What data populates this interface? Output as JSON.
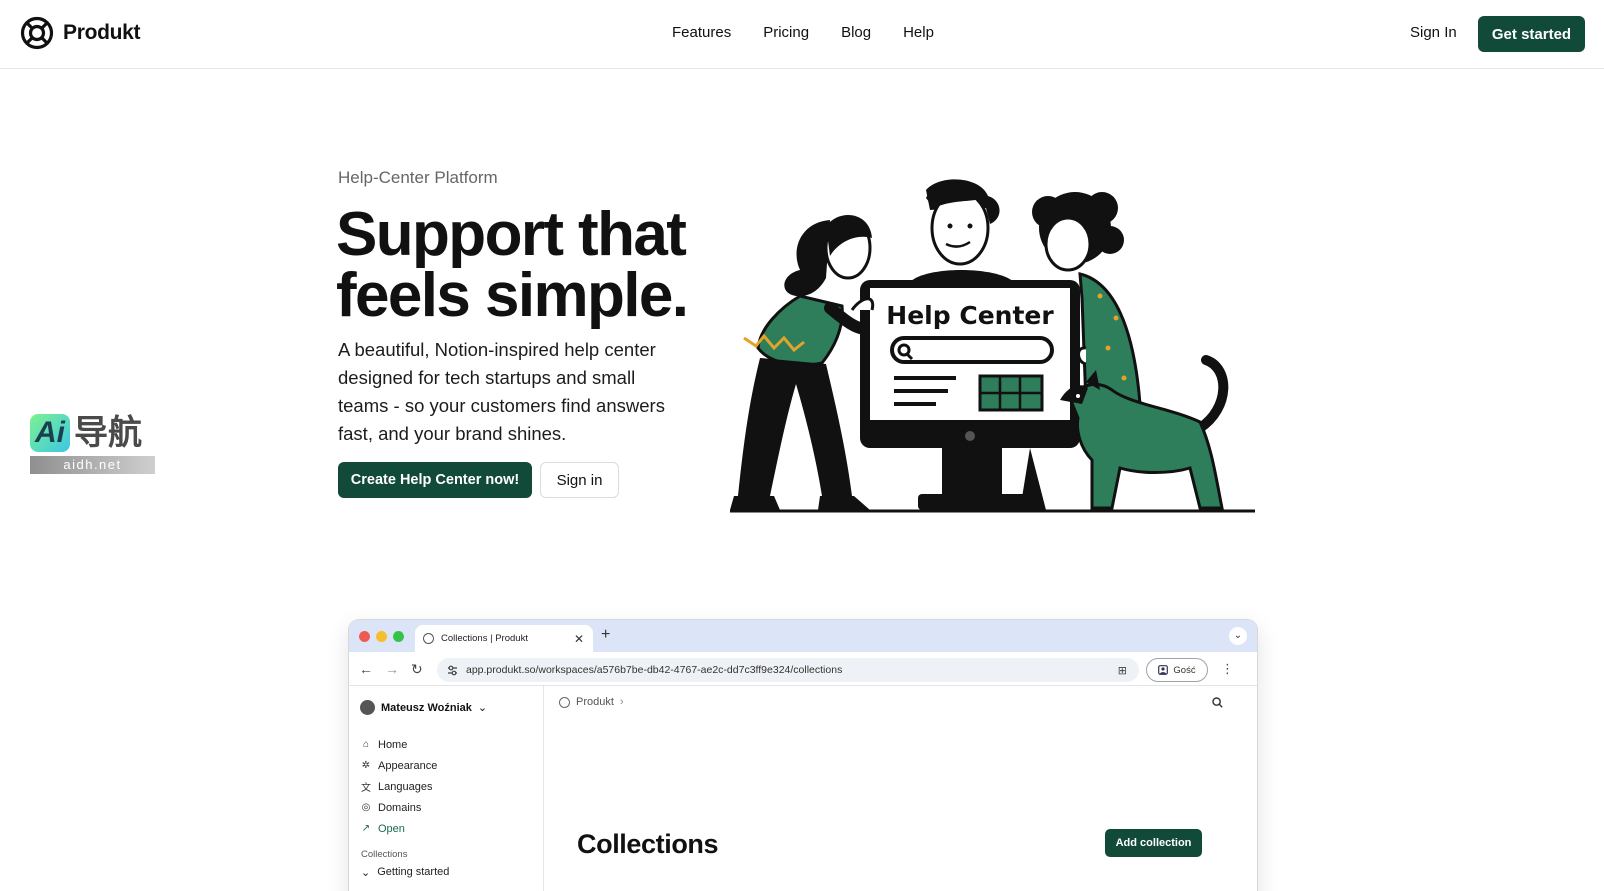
{
  "brand": {
    "name": "Produkt"
  },
  "nav": {
    "links": [
      "Features",
      "Pricing",
      "Blog",
      "Help"
    ],
    "sign_in": "Sign In",
    "get_started": "Get started"
  },
  "hero": {
    "eyebrow": "Help-Center Platform",
    "title_line1": "Support that",
    "title_line2": "feels simple.",
    "description": "A beautiful, Notion-inspired help center designed for tech startups and small teams - so your customers find answers fast, and your brand shines.",
    "cta_primary": "Create Help Center now!",
    "cta_secondary": "Sign in"
  },
  "illustration": {
    "screen_title": "Help Center"
  },
  "watermark": {
    "badge": "Ai",
    "text": "导航",
    "url": "aidh.net"
  },
  "browser": {
    "tab_title": "Collections | Produkt",
    "url": "app.produkt.so/workspaces/a576b7be-db42-4767-ae2c-dd7c3ff9e324/collections",
    "guest_label": "Gość",
    "app": {
      "user_name": "Mateusz Woźniak",
      "menu": [
        {
          "label": "Home",
          "icon": "home-icon"
        },
        {
          "label": "Appearance",
          "icon": "sparkle-icon"
        },
        {
          "label": "Languages",
          "icon": "translate-icon"
        },
        {
          "label": "Domains",
          "icon": "globe-icon"
        },
        {
          "label": "Open",
          "icon": "external-arrow-icon"
        }
      ],
      "collections_label": "Collections",
      "collection_item": "Getting started",
      "breadcrumb": "Produkt",
      "page_title": "Collections",
      "add_collection": "Add collection"
    }
  },
  "colors": {
    "accent": "#124a3a",
    "illustration_green": "#2e7d5b",
    "ink": "#111111"
  }
}
